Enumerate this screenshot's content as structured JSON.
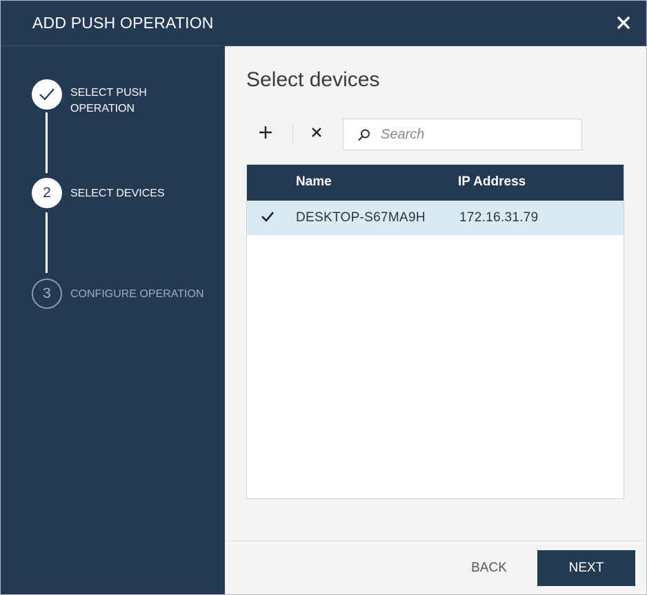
{
  "dialog": {
    "title": "ADD PUSH OPERATION"
  },
  "steps": [
    {
      "number": "1",
      "label_line1": "SELECT PUSH",
      "label_line2": "OPERATION",
      "state": "done"
    },
    {
      "number": "2",
      "label": "SELECT DEVICES",
      "state": "active"
    },
    {
      "number": "3",
      "label": "CONFIGURE OPERATION",
      "state": "future"
    }
  ],
  "main": {
    "heading": "Select devices",
    "search": {
      "placeholder": "Search",
      "value": ""
    },
    "table": {
      "columns": [
        "Name",
        "IP Address"
      ],
      "rows": [
        {
          "checked": true,
          "name": "DESKTOP-S67MA9H",
          "ip": "172.16.31.79"
        }
      ]
    }
  },
  "footer": {
    "back_label": "BACK",
    "next_label": "NEXT"
  },
  "colors": {
    "navy": "#243a54",
    "selected_row": "#d8eaf3",
    "background": "#f4f4f4"
  },
  "icons": {
    "close": "close-icon",
    "add": "plus-icon",
    "remove": "x-icon",
    "search": "search-icon",
    "done": "checkmark-icon"
  }
}
